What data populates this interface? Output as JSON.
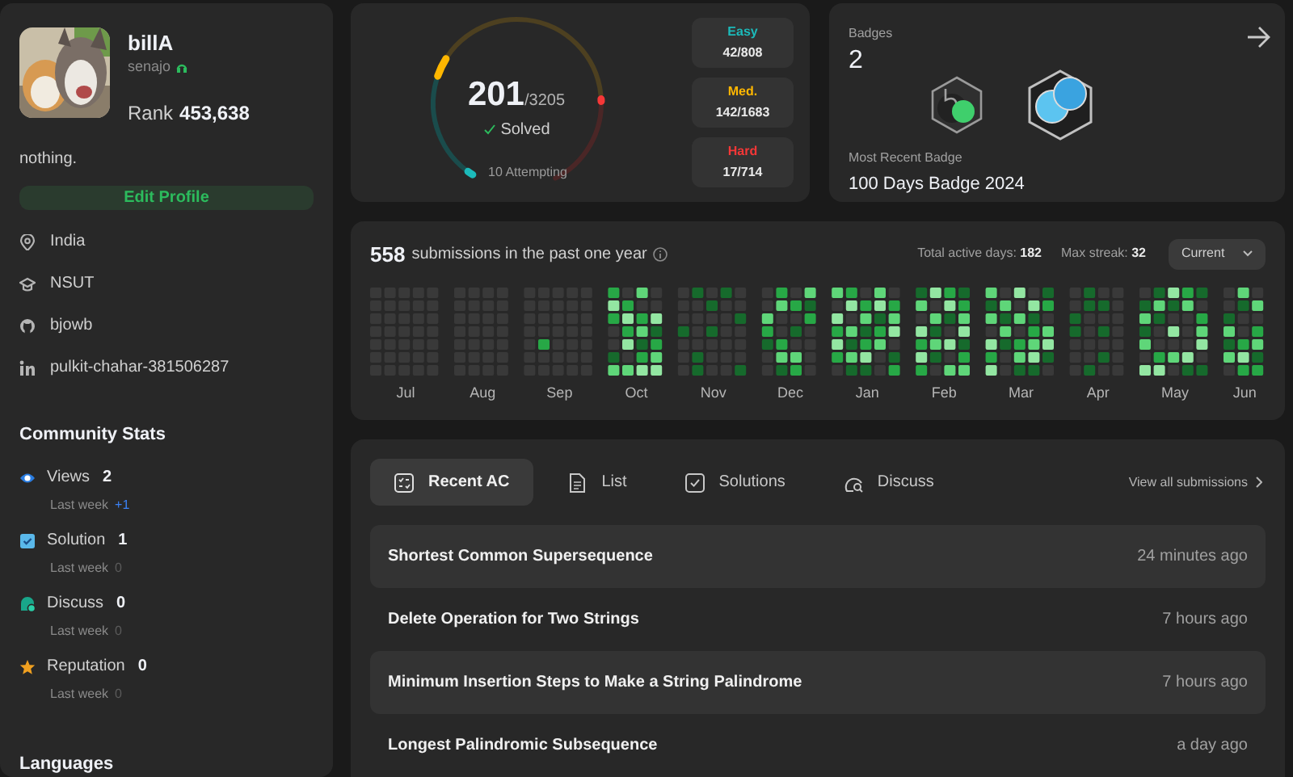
{
  "profile": {
    "username": "billA",
    "handle": "senajo",
    "rank_label": "Rank",
    "rank": "453,638",
    "bio": "nothing.",
    "edit_button": "Edit Profile",
    "info": [
      {
        "kind": "location",
        "text": "India"
      },
      {
        "kind": "school",
        "text": "NSUT"
      },
      {
        "kind": "github",
        "text": "bjowb"
      },
      {
        "kind": "linkedin",
        "text": "pulkit-chahar-381506287"
      }
    ]
  },
  "community_stats": {
    "title": "Community Stats",
    "items": [
      {
        "kind": "views",
        "label": "Views",
        "value": "2",
        "sub_label": "Last week",
        "delta": "+1",
        "delta_positive": true
      },
      {
        "kind": "solution",
        "label": "Solution",
        "value": "1",
        "sub_label": "Last week",
        "delta": "0",
        "delta_positive": false
      },
      {
        "kind": "discuss",
        "label": "Discuss",
        "value": "0",
        "sub_label": "Last week",
        "delta": "0",
        "delta_positive": false
      },
      {
        "kind": "reputation",
        "label": "Reputation",
        "value": "0",
        "sub_label": "Last week",
        "delta": "0",
        "delta_positive": false
      }
    ]
  },
  "languages": {
    "title": "Languages"
  },
  "solved": {
    "count": "201",
    "total": "/3205",
    "label": "Solved",
    "attempting": "10 Attempting",
    "difficulties": [
      {
        "kind": "easy",
        "label": "Easy",
        "count": "42/808"
      },
      {
        "kind": "medium",
        "label": "Med.",
        "count": "142/1683"
      },
      {
        "kind": "hard",
        "label": "Hard",
        "count": "17/714"
      }
    ]
  },
  "badges": {
    "title": "Badges",
    "count": "2",
    "items": [
      {
        "kind": "fifty_days"
      },
      {
        "kind": "hundred_days"
      }
    ],
    "recent_label": "Most Recent Badge",
    "recent_name": "100 Days Badge 2024"
  },
  "calendar": {
    "count": "558",
    "label": "submissions in the past one year",
    "active_days": "Total active days: **182**",
    "max_streak": "Max streak: **32**",
    "selector": "Current",
    "months": [
      "Jul",
      "Aug",
      "Sep",
      "Oct",
      "Nov",
      "Dec",
      "Jan",
      "Feb",
      "Mar",
      "Apr",
      "May",
      "Jun"
    ]
  },
  "activity": {
    "tabs": [
      {
        "kind": "recent",
        "label": "Recent AC",
        "selected": true
      },
      {
        "kind": "list",
        "label": "List",
        "selected": false
      },
      {
        "kind": "solutions",
        "label": "Solutions",
        "selected": false
      },
      {
        "kind": "discuss",
        "label": "Discuss",
        "selected": false
      }
    ],
    "view_all": "View all submissions",
    "rows": [
      {
        "title": "Shortest Common Supersequence",
        "time": "24 minutes ago"
      },
      {
        "title": "Delete Operation for Two Strings",
        "time": "7 hours ago"
      },
      {
        "title": "Minimum Insertion Steps to Make a String Palindrome",
        "time": "7 hours ago"
      },
      {
        "title": "Longest Palindromic Subsequence",
        "time": "a day ago"
      }
    ]
  }
}
